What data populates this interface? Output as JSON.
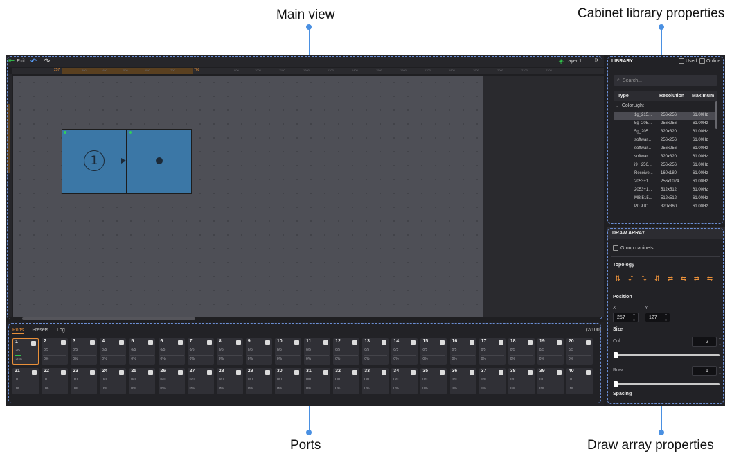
{
  "annotations": {
    "main_view": "Main view",
    "cabinet_library": "Cabinet library properties",
    "ports": "Ports",
    "draw_array": "Draw array properties"
  },
  "toolbar": {
    "exit_label": "Exit",
    "exit_icon": "exit-icon",
    "undo_icon": "undo-icon",
    "redo_icon": "redo-icon",
    "layer_label": "Layer 1",
    "layer_icon": "layers-icon",
    "collapse_icon": "double-chevron-right-icon"
  },
  "ruler": {
    "start_marker": "257",
    "end_marker": "768",
    "ticks": [
      "300",
      "400",
      "500",
      "600",
      "700",
      "900",
      "1000",
      "1100",
      "1200",
      "1300",
      "1400",
      "1500",
      "1600",
      "1700",
      "1800",
      "1900",
      "2000",
      "2100",
      "2200"
    ]
  },
  "canvas": {
    "cabinet_badge": "1",
    "colors": {
      "cabinet_fill": "#3b77a6",
      "canvas_bg": "#4e4f56",
      "accent": "#e9903a",
      "ok_green": "#31c24a"
    }
  },
  "ports_panel": {
    "tabs": [
      "Ports",
      "Presets",
      "Log"
    ],
    "active_tab": "Ports",
    "count": "(2/100)",
    "row1": [
      {
        "num": "1",
        "ratio": "2/5",
        "pct": "20%"
      },
      {
        "num": "2",
        "ratio": "0/5",
        "pct": "0%"
      },
      {
        "num": "3",
        "ratio": "0/5",
        "pct": "0%"
      },
      {
        "num": "4",
        "ratio": "0/5",
        "pct": "0%"
      },
      {
        "num": "5",
        "ratio": "0/5",
        "pct": "0%"
      },
      {
        "num": "6",
        "ratio": "0/5",
        "pct": "0%"
      },
      {
        "num": "7",
        "ratio": "0/5",
        "pct": "0%"
      },
      {
        "num": "8",
        "ratio": "0/5",
        "pct": "0%"
      },
      {
        "num": "9",
        "ratio": "0/5",
        "pct": "0%"
      },
      {
        "num": "10",
        "ratio": "0/5",
        "pct": "0%"
      },
      {
        "num": "11",
        "ratio": "0/5",
        "pct": "0%"
      },
      {
        "num": "12",
        "ratio": "0/5",
        "pct": "0%"
      },
      {
        "num": "13",
        "ratio": "0/5",
        "pct": "0%"
      },
      {
        "num": "14",
        "ratio": "0/5",
        "pct": "0%"
      },
      {
        "num": "15",
        "ratio": "0/5",
        "pct": "0%"
      },
      {
        "num": "16",
        "ratio": "0/5",
        "pct": "0%"
      },
      {
        "num": "17",
        "ratio": "0/5",
        "pct": "0%"
      },
      {
        "num": "18",
        "ratio": "0/5",
        "pct": "0%"
      },
      {
        "num": "19",
        "ratio": "0/5",
        "pct": "0%"
      },
      {
        "num": "20",
        "ratio": "0/5",
        "pct": "0%"
      }
    ],
    "row2": [
      {
        "num": "21",
        "ratio": "0/0",
        "pct": "0%"
      },
      {
        "num": "22",
        "ratio": "0/0",
        "pct": "0%"
      },
      {
        "num": "23",
        "ratio": "0/0",
        "pct": "0%"
      },
      {
        "num": "24",
        "ratio": "0/0",
        "pct": "0%"
      },
      {
        "num": "25",
        "ratio": "0/0",
        "pct": "0%"
      },
      {
        "num": "26",
        "ratio": "0/0",
        "pct": "0%"
      },
      {
        "num": "27",
        "ratio": "0/0",
        "pct": "0%"
      },
      {
        "num": "28",
        "ratio": "0/0",
        "pct": "0%"
      },
      {
        "num": "29",
        "ratio": "0/0",
        "pct": "0%"
      },
      {
        "num": "30",
        "ratio": "0/0",
        "pct": "0%"
      },
      {
        "num": "31",
        "ratio": "0/0",
        "pct": "0%"
      },
      {
        "num": "32",
        "ratio": "0/0",
        "pct": "0%"
      },
      {
        "num": "33",
        "ratio": "0/0",
        "pct": "0%"
      },
      {
        "num": "34",
        "ratio": "0/0",
        "pct": "0%"
      },
      {
        "num": "35",
        "ratio": "0/0",
        "pct": "0%"
      },
      {
        "num": "36",
        "ratio": "0/0",
        "pct": "0%"
      },
      {
        "num": "37",
        "ratio": "0/0",
        "pct": "0%"
      },
      {
        "num": "38",
        "ratio": "0/0",
        "pct": "0%"
      },
      {
        "num": "39",
        "ratio": "0/0",
        "pct": "0%"
      },
      {
        "num": "40",
        "ratio": "0/0",
        "pct": "0%"
      }
    ]
  },
  "library": {
    "title": "LIBRARY",
    "used_label": "Used",
    "online_label": "Online",
    "search_placeholder": "Search...",
    "columns": [
      "Type",
      "Resolution",
      "Maximum"
    ],
    "group": "ColorLight",
    "rows": [
      {
        "type": "1g_215...",
        "res": "256x256",
        "max": "61.00Hz"
      },
      {
        "type": "5g_205...",
        "res": "256x256",
        "max": "61.00Hz"
      },
      {
        "type": "5g_205...",
        "res": "320x320",
        "max": "61.00Hz"
      },
      {
        "type": "softwar...",
        "res": "256x256",
        "max": "61.00Hz"
      },
      {
        "type": "softwar...",
        "res": "256x256",
        "max": "61.00Hz"
      },
      {
        "type": "softwar...",
        "res": "320x320",
        "max": "61.00Hz"
      },
      {
        "type": "i9+ 256...",
        "res": "256x256",
        "max": "61.00Hz"
      },
      {
        "type": "Receive...",
        "res": "160x180",
        "max": "61.00Hz"
      },
      {
        "type": "2053+1...",
        "res": "256x1024",
        "max": "61.00Hz"
      },
      {
        "type": "2053+1...",
        "res": "512x512",
        "max": "61.00Hz"
      },
      {
        "type": "MBI515...",
        "res": "512x512",
        "max": "61.00Hz"
      },
      {
        "type": "P0.9 IC...",
        "res": "320x360",
        "max": "61.00Hz"
      }
    ]
  },
  "draw_array": {
    "title": "DRAW ARRAY",
    "group_label": "Group cabinets",
    "topology_label": "Topology",
    "topology_icons": [
      "topology-1-icon",
      "topology-2-icon",
      "topology-3-icon",
      "topology-4-icon",
      "topology-5-icon",
      "topology-6-icon",
      "topology-7-icon",
      "topology-8-icon"
    ],
    "position_label": "Position",
    "x_label": "X",
    "y_label": "Y",
    "x_value": "257",
    "y_value": "127",
    "size_label": "Size",
    "col_label": "Col",
    "col_value": "2",
    "row_label": "Row",
    "row_value": "1",
    "spacing_label": "Spacing"
  }
}
